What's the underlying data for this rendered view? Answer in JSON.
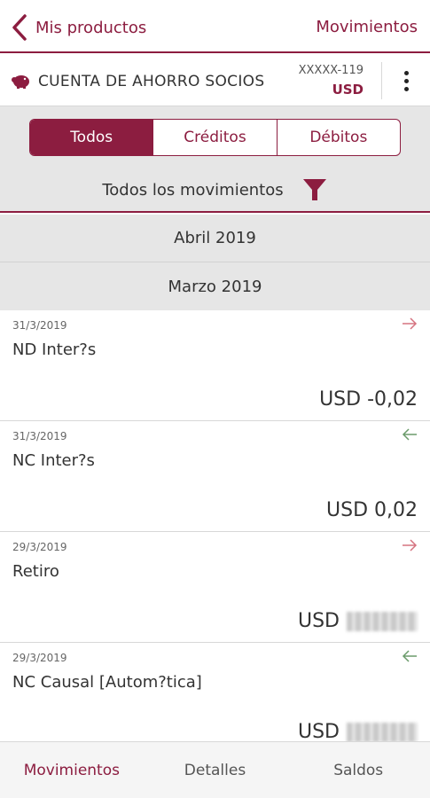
{
  "colors": {
    "brand": "#8c1d40",
    "credit_arrow": "#6a9b6a",
    "debit_arrow": "#d5727f",
    "panel": "#e6e6e6"
  },
  "header": {
    "back_label": "Mis productos",
    "title": "Movimientos"
  },
  "account": {
    "name": "CUENTA DE AHORRO SOCIOS",
    "number": "XXXXX-119",
    "currency": "USD"
  },
  "filters": {
    "tabs": [
      {
        "label": "Todos",
        "active": true
      },
      {
        "label": "Créditos",
        "active": false
      },
      {
        "label": "Débitos",
        "active": false
      }
    ],
    "label": "Todos los movimientos"
  },
  "months": [
    "Abril 2019",
    "Marzo 2019"
  ],
  "transactions": [
    {
      "date": "31/3/2019",
      "description": "ND Inter?s",
      "direction": "debit",
      "amount": "USD -0,02"
    },
    {
      "date": "31/3/2019",
      "description": "NC Inter?s",
      "direction": "credit",
      "amount": "USD 0,02"
    },
    {
      "date": "29/3/2019",
      "description": "Retiro",
      "direction": "debit",
      "amount": "USD"
    },
    {
      "date": "29/3/2019",
      "description": "NC Causal [Autom?tica]",
      "direction": "credit",
      "amount": "USD"
    }
  ],
  "bottom_nav": [
    {
      "label": "Movimientos",
      "selected": true
    },
    {
      "label": "Detalles",
      "selected": false
    },
    {
      "label": "Saldos",
      "selected": false
    }
  ]
}
